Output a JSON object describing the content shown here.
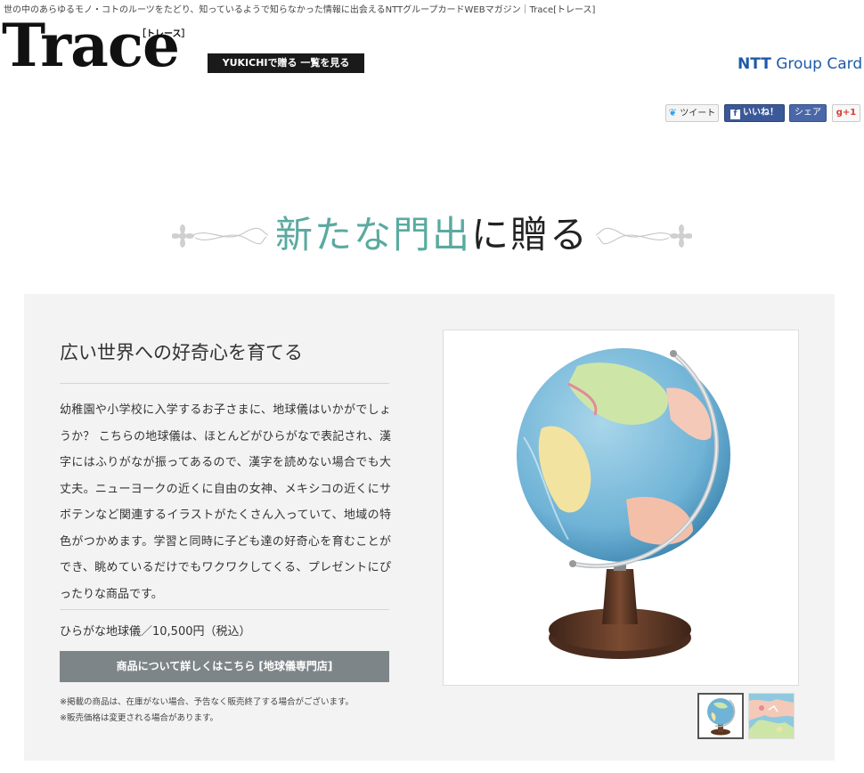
{
  "header": {
    "tagline": "世の中のあらゆるモノ・コトのルーツをたどり、知っているようで知らなかった情報に出会えるNTTグループカードWEBマガジン｜Trace[トレース]",
    "logo_text": "Trace",
    "logo_sub": "［トレース］",
    "yukichi_button": "YUKICHIで贈る 一覧を見る",
    "brand_bold": "NTT",
    "brand_rest": " Group Card"
  },
  "social": {
    "tweet": "ツイート",
    "like": "いいね！",
    "like_icon": "f",
    "share": "シェア",
    "gplus": "g+1"
  },
  "section": {
    "heading_accent": "新たな門出",
    "heading_rest": "に贈る"
  },
  "product": {
    "title": "広い世界への好奇心を育てる",
    "description": "幼稚園や小学校に入学するお子さまに、地球儀はいかがでしょうか？ こちらの地球儀は、ほとんどがひらがなで表記され、漢字にはふりがなが振ってあるので、漢字を読めない場合でも大丈夫。ニューヨークの近くに自由の女神、メキシコの近くにサボテンなど関連するイラストがたくさん入っていて、地域の特色がつかめます。学習と同時に子ども達の好奇心を育むことができ、眺めているだけでもワクワクしてくる、プレゼントにぴったりな商品です。",
    "price": "ひらがな地球儀／10,500円（税込）",
    "detail_button": "商品について詳しくはこちら [地球儀専門店]",
    "note1": "※掲載の商品は、在庫がない場合、予告なく販売終了する場合がございます。",
    "note2": "※販売価格は変更される場合があります。"
  },
  "colors": {
    "accent": "#5aaaa0",
    "ntt_blue": "#1e5aa8",
    "button_gray": "#7e8588",
    "panel": "#f3f3f3"
  }
}
